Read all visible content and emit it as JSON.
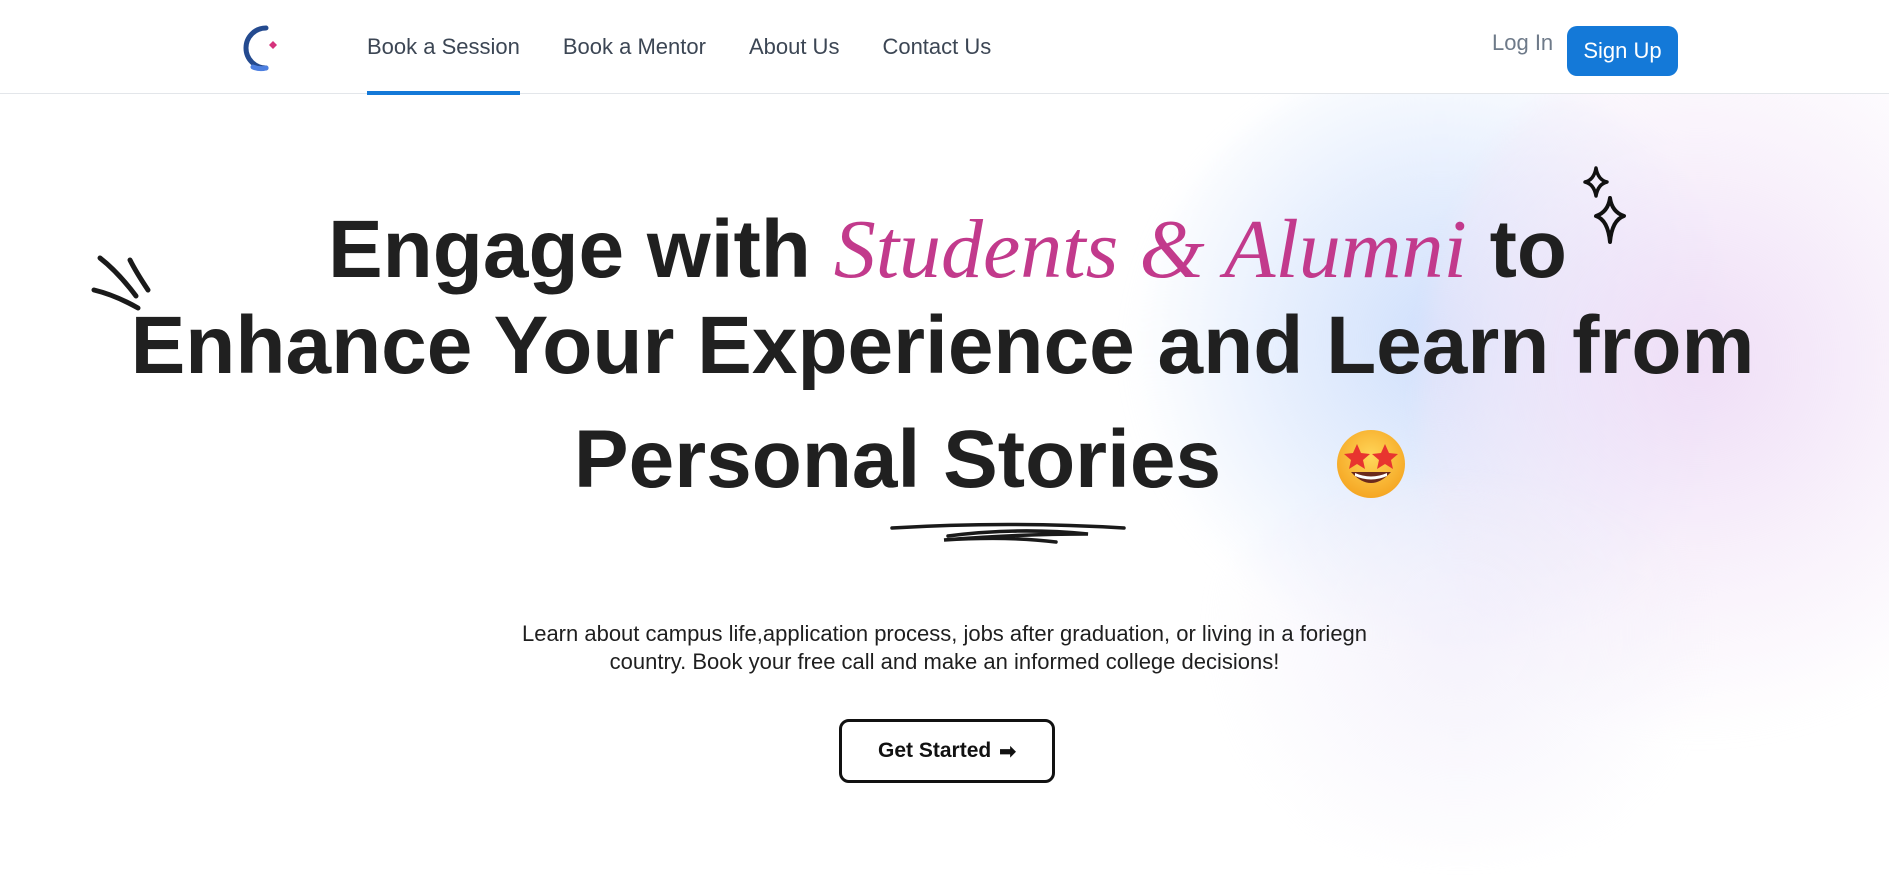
{
  "nav": {
    "links": [
      {
        "label": "Book a Session",
        "active": true
      },
      {
        "label": "Book a Mentor",
        "active": false
      },
      {
        "label": "About Us",
        "active": false
      },
      {
        "label": "Contact Us",
        "active": false
      }
    ],
    "login_label": "Log In",
    "signup_label": "Sign Up"
  },
  "hero": {
    "line1_start": "Engage with",
    "line1_highlight": "Students & Alumni",
    "line1_end": "to",
    "line2": "Enhance Your Experience and Learn from",
    "line3": "Personal Stories",
    "emoji_icon": "star-struck-emoji-icon"
  },
  "subtitle": {
    "line1": "Learn about campus life,application process, jobs after graduation, or living in a foriegn",
    "line2": "country. Book your free call and make an informed college decisions!"
  },
  "cta": {
    "label": "Get Started",
    "arrow": "➡"
  },
  "colors": {
    "accent": "#1479d8",
    "highlight": "#c23a8c",
    "text": "#202020"
  }
}
